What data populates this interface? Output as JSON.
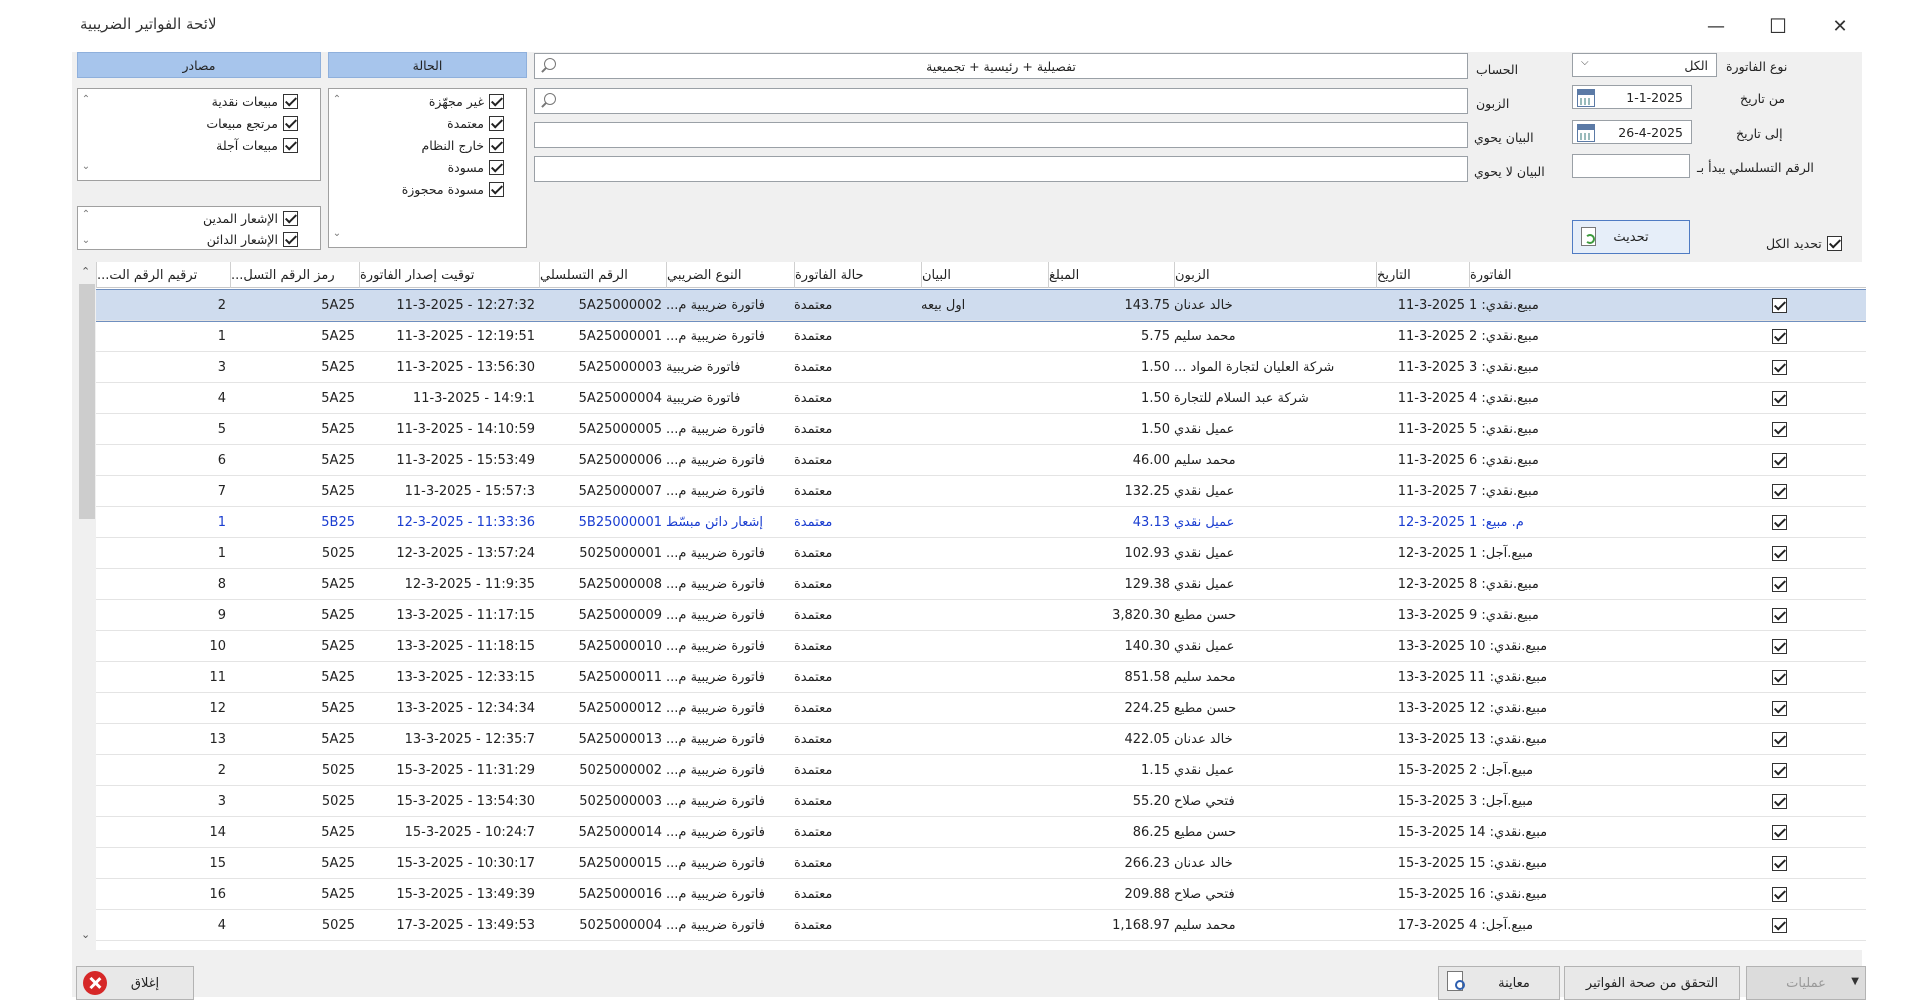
{
  "window": {
    "title": "لائحة الفواتير الضريبية",
    "minimize": "—",
    "maximize": "☐",
    "close": "✕"
  },
  "filters": {
    "invoice_type_label": "نوع الفاتورة",
    "invoice_type_value": "الكل",
    "from_date_label": "من تاريخ",
    "from_date_value": "1-1-2025",
    "to_date_label": "إلى تاريخ",
    "to_date_value": "26-4-2025",
    "serial_starts_label": "الرقم التسلسلي يبدأ بـ",
    "serial_starts_value": "",
    "account_label": "الحساب",
    "account_value": "تفصيلية + رئيسية + تجميعية",
    "customer_label": "الزبون",
    "customer_value": "",
    "contains_label": "البيان يحوي",
    "contains_value": "",
    "not_contains_label": "البيان لا يحوي",
    "not_contains_value": "",
    "refresh_label": "تحديث",
    "select_all_label": "تحديد الكل"
  },
  "status_panel": {
    "header": "الحالة",
    "items": [
      "غير مجهّزة",
      "معتمدة",
      "خارج النظام",
      "مسودة",
      "مسودة محجوزة"
    ]
  },
  "sources_panel": {
    "header": "مصادر",
    "items": [
      "مبيعات نقدية",
      "مرتجع مبيعات",
      "مبيعات آجلة"
    ]
  },
  "notice_panel": {
    "items": [
      "الإشعار المدين",
      "الإشعار الدائن"
    ]
  },
  "columns": [
    "الفاتورة",
    "التاريخ",
    "الزبون",
    "المبلغ",
    "البيان",
    "حالة الفاتورة",
    "النوع الضريبي",
    "الرقم التسلسلي",
    "توقيت إصدار الفاتورة",
    "رمز الرقم التسل...",
    "ترقيم الرقم الت..."
  ],
  "rows": [
    {
      "inv": "مبيع.نقدي: 1",
      "date": "11-3-2025",
      "cust": "خالد عدنان",
      "amt": "143.75",
      "desc": "اول بيعه",
      "status": "معتمدة",
      "tax": "فاتورة ضريبية م...",
      "serial": "5A25000002",
      "time": "11-3-2025 - 12:27:32",
      "code": "5A25",
      "num": "2"
    },
    {
      "inv": "مبيع.نقدي: 2",
      "date": "11-3-2025",
      "cust": "محمد سليم",
      "amt": "5.75",
      "desc": "",
      "status": "معتمدة",
      "tax": "فاتورة ضريبية م...",
      "serial": "5A25000001",
      "time": "11-3-2025 - 12:19:51",
      "code": "5A25",
      "num": "1"
    },
    {
      "inv": "مبيع.نقدي: 3",
      "date": "11-3-2025",
      "cust": "شركة العليان لتجارة المواد ...",
      "amt": "1.50",
      "desc": "",
      "status": "معتمدة",
      "tax": "فاتورة ضريبية",
      "serial": "5A25000003",
      "time": "11-3-2025 - 13:56:30",
      "code": "5A25",
      "num": "3"
    },
    {
      "inv": "مبيع.نقدي: 4",
      "date": "11-3-2025",
      "cust": "شركة عبد السلام للتجارة",
      "amt": "1.50",
      "desc": "",
      "status": "معتمدة",
      "tax": "فاتورة ضريبية",
      "serial": "5A25000004",
      "time": "11-3-2025 - 14:9:1",
      "code": "5A25",
      "num": "4"
    },
    {
      "inv": "مبيع.نقدي: 5",
      "date": "11-3-2025",
      "cust": "عميل نقدي",
      "amt": "1.50",
      "desc": "",
      "status": "معتمدة",
      "tax": "فاتورة ضريبية م...",
      "serial": "5A25000005",
      "time": "11-3-2025 - 14:10:59",
      "code": "5A25",
      "num": "5"
    },
    {
      "inv": "مبيع.نقدي: 6",
      "date": "11-3-2025",
      "cust": "محمد سليم",
      "amt": "46.00",
      "desc": "",
      "status": "معتمدة",
      "tax": "فاتورة ضريبية م...",
      "serial": "5A25000006",
      "time": "11-3-2025 - 15:53:49",
      "code": "5A25",
      "num": "6"
    },
    {
      "inv": "مبيع.نقدي: 7",
      "date": "11-3-2025",
      "cust": "عميل نقدي",
      "amt": "132.25",
      "desc": "",
      "status": "معتمدة",
      "tax": "فاتورة ضريبية م...",
      "serial": "5A25000007",
      "time": "11-3-2025 - 15:57:3",
      "code": "5A25",
      "num": "7"
    },
    {
      "inv": "م. مبيع: 1",
      "date": "12-3-2025",
      "cust": "عميل نقدي",
      "amt": "43.13",
      "desc": "",
      "status": "معتمدة",
      "tax": "إشعار دائن مبسّط",
      "serial": "5B25000001",
      "time": "12-3-2025 - 11:33:36",
      "code": "5B25",
      "num": "1",
      "blue": true
    },
    {
      "inv": "مبيع.آجل: 1",
      "date": "12-3-2025",
      "cust": "عميل نقدي",
      "amt": "102.93",
      "desc": "",
      "status": "معتمدة",
      "tax": "فاتورة ضريبية م...",
      "serial": "5025000001",
      "time": "12-3-2025 - 13:57:24",
      "code": "5025",
      "num": "1"
    },
    {
      "inv": "مبيع.نقدي: 8",
      "date": "12-3-2025",
      "cust": "عميل نقدي",
      "amt": "129.38",
      "desc": "",
      "status": "معتمدة",
      "tax": "فاتورة ضريبية م...",
      "serial": "5A25000008",
      "time": "12-3-2025 - 11:9:35",
      "code": "5A25",
      "num": "8"
    },
    {
      "inv": "مبيع.نقدي: 9",
      "date": "13-3-2025",
      "cust": "حسن مطيع",
      "amt": "3,820.30",
      "desc": "",
      "status": "معتمدة",
      "tax": "فاتورة ضريبية م...",
      "serial": "5A25000009",
      "time": "13-3-2025 - 11:17:15",
      "code": "5A25",
      "num": "9"
    },
    {
      "inv": "مبيع.نقدي: 10",
      "date": "13-3-2025",
      "cust": "عميل نقدي",
      "amt": "140.30",
      "desc": "",
      "status": "معتمدة",
      "tax": "فاتورة ضريبية م...",
      "serial": "5A25000010",
      "time": "13-3-2025 - 11:18:15",
      "code": "5A25",
      "num": "10"
    },
    {
      "inv": "مبيع.نقدي: 11",
      "date": "13-3-2025",
      "cust": "محمد سليم",
      "amt": "851.58",
      "desc": "",
      "status": "معتمدة",
      "tax": "فاتورة ضريبية م...",
      "serial": "5A25000011",
      "time": "13-3-2025 - 12:33:15",
      "code": "5A25",
      "num": "11"
    },
    {
      "inv": "مبيع.نقدي: 12",
      "date": "13-3-2025",
      "cust": "حسن مطيع",
      "amt": "224.25",
      "desc": "",
      "status": "معتمدة",
      "tax": "فاتورة ضريبية م...",
      "serial": "5A25000012",
      "time": "13-3-2025 - 12:34:34",
      "code": "5A25",
      "num": "12"
    },
    {
      "inv": "مبيع.نقدي: 13",
      "date": "13-3-2025",
      "cust": "خالد عدنان",
      "amt": "422.05",
      "desc": "",
      "status": "معتمدة",
      "tax": "فاتورة ضريبية م...",
      "serial": "5A25000013",
      "time": "13-3-2025 - 12:35:7",
      "code": "5A25",
      "num": "13"
    },
    {
      "inv": "مبيع.آجل: 2",
      "date": "15-3-2025",
      "cust": "عميل نقدي",
      "amt": "1.15",
      "desc": "",
      "status": "معتمدة",
      "tax": "فاتورة ضريبية م...",
      "serial": "5025000002",
      "time": "15-3-2025 - 11:31:29",
      "code": "5025",
      "num": "2"
    },
    {
      "inv": "مبيع.آجل: 3",
      "date": "15-3-2025",
      "cust": "فتحي صلاح",
      "amt": "55.20",
      "desc": "",
      "status": "معتمدة",
      "tax": "فاتورة ضريبية م...",
      "serial": "5025000003",
      "time": "15-3-2025 - 13:54:30",
      "code": "5025",
      "num": "3"
    },
    {
      "inv": "مبيع.نقدي: 14",
      "date": "15-3-2025",
      "cust": "حسن مطيع",
      "amt": "86.25",
      "desc": "",
      "status": "معتمدة",
      "tax": "فاتورة ضريبية م...",
      "serial": "5A25000014",
      "time": "15-3-2025 - 10:24:7",
      "code": "5A25",
      "num": "14"
    },
    {
      "inv": "مبيع.نقدي: 15",
      "date": "15-3-2025",
      "cust": "خالد عدنان",
      "amt": "266.23",
      "desc": "",
      "status": "معتمدة",
      "tax": "فاتورة ضريبية م...",
      "serial": "5A25000015",
      "time": "15-3-2025 - 10:30:17",
      "code": "5A25",
      "num": "15"
    },
    {
      "inv": "مبيع.نقدي: 16",
      "date": "15-3-2025",
      "cust": "فتحي صلاح",
      "amt": "209.88",
      "desc": "",
      "status": "معتمدة",
      "tax": "فاتورة ضريبية م...",
      "serial": "5A25000016",
      "time": "15-3-2025 - 13:49:39",
      "code": "5A25",
      "num": "16"
    },
    {
      "inv": "مبيع.آجل: 4",
      "date": "17-3-2025",
      "cust": "محمد سليم",
      "amt": "1,168.97",
      "desc": "",
      "status": "معتمدة",
      "tax": "فاتورة ضريبية م...",
      "serial": "5025000004",
      "time": "17-3-2025 - 13:49:53",
      "code": "5025",
      "num": "4"
    }
  ],
  "footer": {
    "close_label": "إغلاق",
    "preview_label": "معاينة",
    "verify_label": "التحقق من صحة الفواتير",
    "operations_label": "عمليات"
  },
  "colors": {
    "selected_row": "#cfdcee",
    "credit_note_text": "#1a3dd0",
    "panel_header": "#a7c5ec",
    "close_red": "#d62828"
  }
}
